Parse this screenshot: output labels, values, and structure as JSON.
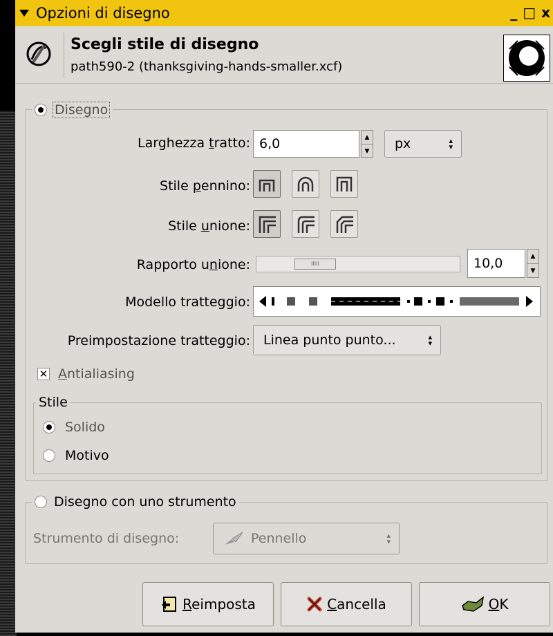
{
  "window": {
    "title": "Opzioni di disegno",
    "controls": [
      "_",
      "□",
      "x"
    ],
    "header_title": "Scegli stile di disegno",
    "header_subtitle": "path590-2 (thanksgiving-hands-smaller.xcf)"
  },
  "stroke_group": {
    "legend": "Disegno",
    "line_width_label_pre": "Larghezza ",
    "line_width_label_u": "t",
    "line_width_label_post": "ratto:",
    "line_width_value": "6,0",
    "unit_value": "px",
    "cap_label_pre": "Stile ",
    "cap_label_u": "p",
    "cap_label_post": "ennino:",
    "join_label_pre": "Stile ",
    "join_label_u": "u",
    "join_label_post": "nione:",
    "miter_label_pre": "Rapporto u",
    "miter_label_u": "n",
    "miter_label_post": "ione:",
    "miter_value": "10,0",
    "miter_fraction": 0.14,
    "dash_pattern_label": "Modello tratteggio:",
    "dash_preset_label": "Preimpostazione tratteggio:",
    "dash_preset_value": "Linea punto punto...",
    "antialias_label_u": "A",
    "antialias_label_post": "ntialiasing",
    "antialias_checked": true,
    "style_legend": "Stile",
    "style_solid": "Solido",
    "style_pattern": "Motivo",
    "selected_style": "Solido"
  },
  "tool_group": {
    "legend": "Disegno con uno strumento",
    "tool_label": "Strumento di disegno:",
    "tool_value": "Pennello"
  },
  "buttons": {
    "reset_u": "R",
    "reset_post": "eimposta",
    "cancel_u": "C",
    "cancel_post": "ancella",
    "ok_u": "O",
    "ok_post": "K"
  },
  "colors": {
    "titlebar": "#f1c40f",
    "background": "#dcdad5",
    "cancel_icon": "#c0392b",
    "ok_icon": "#6e8a3a"
  }
}
